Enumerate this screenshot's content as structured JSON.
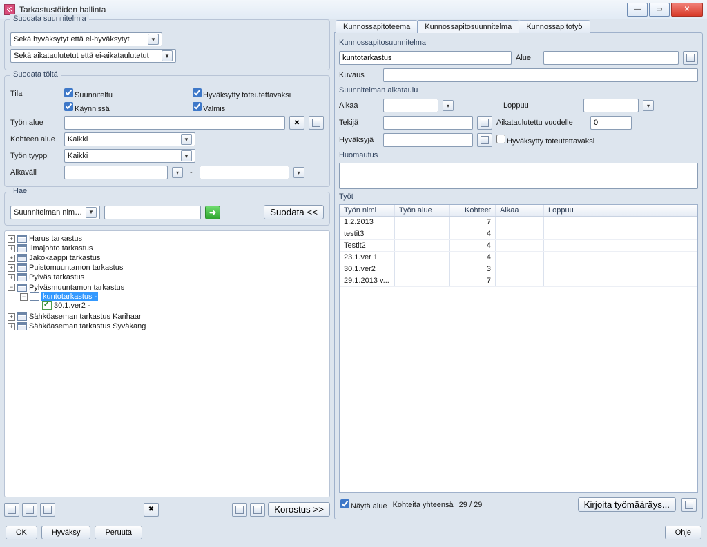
{
  "window": {
    "title": "Tarkastustöiden hallinta"
  },
  "left": {
    "filter_plans": {
      "title": "Suodata suunnitelmia",
      "approval": "Sekä hyväksytyt että ei-hyväksytyt",
      "schedule": "Sekä aikataulutetut että ei-aikataulutetut"
    },
    "filter_works": {
      "title": "Suodata töitä",
      "state_label": "Tila",
      "cb_planned": "Suunniteltu",
      "cb_approved": "Hyväksytty toteutettavaksi",
      "cb_running": "Käynnissä",
      "cb_done": "Valmis",
      "work_area": "Työn alue",
      "target_area": "Kohteen alue",
      "target_area_value": "Kaikki",
      "work_type": "Työn tyyppi",
      "work_type_value": "Kaikki",
      "interval": "Aikaväli",
      "dash": "-"
    },
    "search": {
      "title": "Hae",
      "mode": "Suunnitelman nimellä",
      "placeholder": "",
      "button": "Suodata <<"
    },
    "tree": [
      {
        "expand": "+",
        "icon": "cal",
        "label": "Harus tarkastus"
      },
      {
        "expand": "+",
        "icon": "cal",
        "label": "Ilmajohto tarkastus"
      },
      {
        "expand": "+",
        "icon": "cal",
        "label": "Jakokaappi tarkastus"
      },
      {
        "expand": "+",
        "icon": "cal",
        "label": "Puistomuuntamon tarkastus"
      },
      {
        "expand": "+",
        "icon": "cal",
        "label": "Pylväs tarkastus"
      },
      {
        "expand": "-",
        "icon": "cal",
        "label": "Pylväsmuuntamon tarkastus",
        "children": [
          {
            "expand": "-",
            "icon": "doc",
            "label": "kuntotarkastus -",
            "selected": true,
            "children": [
              {
                "expand": "",
                "icon": "check",
                "label": "30.1.ver2 -"
              }
            ]
          }
        ]
      },
      {
        "expand": "+",
        "icon": "cal",
        "label": "Sähköaseman tarkastus Karihaar"
      },
      {
        "expand": "+",
        "icon": "cal",
        "label": "Sähköaseman tarkastus Syväkang"
      }
    ],
    "toolbar": {
      "highlight": "Korostus >>"
    }
  },
  "right": {
    "tabs": {
      "t1": "Kunnossapitoteema",
      "t2": "Kunnossapitosuunnitelma",
      "t3": "Kunnossapitotyö"
    },
    "form": {
      "title": "Kunnossapitosuunnitelma",
      "name_value": "kuntotarkastus",
      "area_label": "Alue",
      "desc_label": "Kuvaus",
      "schedule_title": "Suunnitelman aikataulu",
      "start_label": "Alkaa",
      "end_label": "Loppuu",
      "author_label": "Tekijä",
      "sched_year_label": "Aikataulutettu vuodelle",
      "sched_year_value": "0",
      "approver_label": "Hyväksyjä",
      "approved_cb": "Hyväksytty toteutettavaksi",
      "note_label": "Huomautus"
    },
    "works": {
      "title": "Työt",
      "headers": {
        "name": "Työn nimi",
        "area": "Työn alue",
        "targets": "Kohteet",
        "start": "Alkaa",
        "end": "Loppuu"
      },
      "rows": [
        {
          "name": "1.2.2013",
          "area": "",
          "targets": "7",
          "start": "",
          "end": ""
        },
        {
          "name": "testit3",
          "area": "",
          "targets": "4",
          "start": "",
          "end": ""
        },
        {
          "name": "Testit2",
          "area": "",
          "targets": "4",
          "start": "",
          "end": ""
        },
        {
          "name": "23.1.ver 1",
          "area": "",
          "targets": "4",
          "start": "",
          "end": ""
        },
        {
          "name": "30.1.ver2",
          "area": "",
          "targets": "3",
          "start": "",
          "end": ""
        },
        {
          "name": "29.1.2013 v...",
          "area": "",
          "targets": "7",
          "start": "",
          "end": ""
        }
      ],
      "footer": {
        "show_area": "Näytä alue",
        "total_label": "Kohteita yhteensä",
        "total_value": "29 / 29",
        "write_order": "Kirjoita työmääräys..."
      }
    }
  },
  "bottom": {
    "ok": "OK",
    "approve": "Hyväksy",
    "cancel": "Peruuta",
    "help": "Ohje"
  }
}
